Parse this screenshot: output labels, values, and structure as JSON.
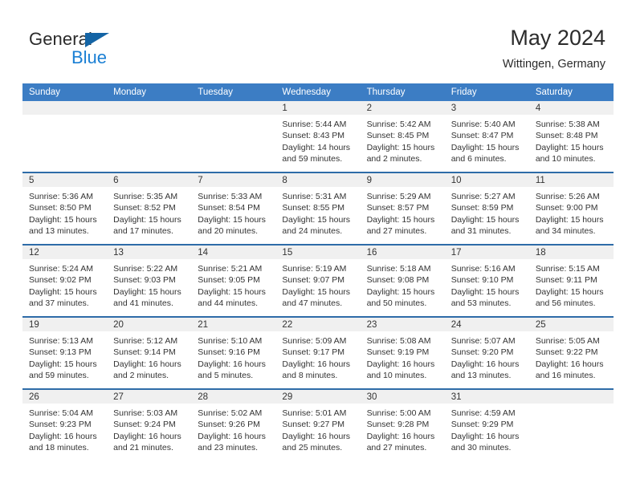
{
  "brand": {
    "name_part1": "General",
    "name_part2": "Blue",
    "triangle_color": "#1464a5",
    "blue_color": "#1a7fd4"
  },
  "header": {
    "title": "May 2024",
    "location": "Wittingen, Germany",
    "header_bg_color": "#3c7dc4",
    "row_border_color": "#2e6ca8"
  },
  "weekdays": [
    "Sunday",
    "Monday",
    "Tuesday",
    "Wednesday",
    "Thursday",
    "Friday",
    "Saturday"
  ],
  "weeks": [
    [
      {
        "day": "",
        "sunrise": "",
        "sunset": "",
        "daylight1": "",
        "daylight2": ""
      },
      {
        "day": "",
        "sunrise": "",
        "sunset": "",
        "daylight1": "",
        "daylight2": ""
      },
      {
        "day": "",
        "sunrise": "",
        "sunset": "",
        "daylight1": "",
        "daylight2": ""
      },
      {
        "day": "1",
        "sunrise": "Sunrise: 5:44 AM",
        "sunset": "Sunset: 8:43 PM",
        "daylight1": "Daylight: 14 hours",
        "daylight2": "and 59 minutes."
      },
      {
        "day": "2",
        "sunrise": "Sunrise: 5:42 AM",
        "sunset": "Sunset: 8:45 PM",
        "daylight1": "Daylight: 15 hours",
        "daylight2": "and 2 minutes."
      },
      {
        "day": "3",
        "sunrise": "Sunrise: 5:40 AM",
        "sunset": "Sunset: 8:47 PM",
        "daylight1": "Daylight: 15 hours",
        "daylight2": "and 6 minutes."
      },
      {
        "day": "4",
        "sunrise": "Sunrise: 5:38 AM",
        "sunset": "Sunset: 8:48 PM",
        "daylight1": "Daylight: 15 hours",
        "daylight2": "and 10 minutes."
      }
    ],
    [
      {
        "day": "5",
        "sunrise": "Sunrise: 5:36 AM",
        "sunset": "Sunset: 8:50 PM",
        "daylight1": "Daylight: 15 hours",
        "daylight2": "and 13 minutes."
      },
      {
        "day": "6",
        "sunrise": "Sunrise: 5:35 AM",
        "sunset": "Sunset: 8:52 PM",
        "daylight1": "Daylight: 15 hours",
        "daylight2": "and 17 minutes."
      },
      {
        "day": "7",
        "sunrise": "Sunrise: 5:33 AM",
        "sunset": "Sunset: 8:54 PM",
        "daylight1": "Daylight: 15 hours",
        "daylight2": "and 20 minutes."
      },
      {
        "day": "8",
        "sunrise": "Sunrise: 5:31 AM",
        "sunset": "Sunset: 8:55 PM",
        "daylight1": "Daylight: 15 hours",
        "daylight2": "and 24 minutes."
      },
      {
        "day": "9",
        "sunrise": "Sunrise: 5:29 AM",
        "sunset": "Sunset: 8:57 PM",
        "daylight1": "Daylight: 15 hours",
        "daylight2": "and 27 minutes."
      },
      {
        "day": "10",
        "sunrise": "Sunrise: 5:27 AM",
        "sunset": "Sunset: 8:59 PM",
        "daylight1": "Daylight: 15 hours",
        "daylight2": "and 31 minutes."
      },
      {
        "day": "11",
        "sunrise": "Sunrise: 5:26 AM",
        "sunset": "Sunset: 9:00 PM",
        "daylight1": "Daylight: 15 hours",
        "daylight2": "and 34 minutes."
      }
    ],
    [
      {
        "day": "12",
        "sunrise": "Sunrise: 5:24 AM",
        "sunset": "Sunset: 9:02 PM",
        "daylight1": "Daylight: 15 hours",
        "daylight2": "and 37 minutes."
      },
      {
        "day": "13",
        "sunrise": "Sunrise: 5:22 AM",
        "sunset": "Sunset: 9:03 PM",
        "daylight1": "Daylight: 15 hours",
        "daylight2": "and 41 minutes."
      },
      {
        "day": "14",
        "sunrise": "Sunrise: 5:21 AM",
        "sunset": "Sunset: 9:05 PM",
        "daylight1": "Daylight: 15 hours",
        "daylight2": "and 44 minutes."
      },
      {
        "day": "15",
        "sunrise": "Sunrise: 5:19 AM",
        "sunset": "Sunset: 9:07 PM",
        "daylight1": "Daylight: 15 hours",
        "daylight2": "and 47 minutes."
      },
      {
        "day": "16",
        "sunrise": "Sunrise: 5:18 AM",
        "sunset": "Sunset: 9:08 PM",
        "daylight1": "Daylight: 15 hours",
        "daylight2": "and 50 minutes."
      },
      {
        "day": "17",
        "sunrise": "Sunrise: 5:16 AM",
        "sunset": "Sunset: 9:10 PM",
        "daylight1": "Daylight: 15 hours",
        "daylight2": "and 53 minutes."
      },
      {
        "day": "18",
        "sunrise": "Sunrise: 5:15 AM",
        "sunset": "Sunset: 9:11 PM",
        "daylight1": "Daylight: 15 hours",
        "daylight2": "and 56 minutes."
      }
    ],
    [
      {
        "day": "19",
        "sunrise": "Sunrise: 5:13 AM",
        "sunset": "Sunset: 9:13 PM",
        "daylight1": "Daylight: 15 hours",
        "daylight2": "and 59 minutes."
      },
      {
        "day": "20",
        "sunrise": "Sunrise: 5:12 AM",
        "sunset": "Sunset: 9:14 PM",
        "daylight1": "Daylight: 16 hours",
        "daylight2": "and 2 minutes."
      },
      {
        "day": "21",
        "sunrise": "Sunrise: 5:10 AM",
        "sunset": "Sunset: 9:16 PM",
        "daylight1": "Daylight: 16 hours",
        "daylight2": "and 5 minutes."
      },
      {
        "day": "22",
        "sunrise": "Sunrise: 5:09 AM",
        "sunset": "Sunset: 9:17 PM",
        "daylight1": "Daylight: 16 hours",
        "daylight2": "and 8 minutes."
      },
      {
        "day": "23",
        "sunrise": "Sunrise: 5:08 AM",
        "sunset": "Sunset: 9:19 PM",
        "daylight1": "Daylight: 16 hours",
        "daylight2": "and 10 minutes."
      },
      {
        "day": "24",
        "sunrise": "Sunrise: 5:07 AM",
        "sunset": "Sunset: 9:20 PM",
        "daylight1": "Daylight: 16 hours",
        "daylight2": "and 13 minutes."
      },
      {
        "day": "25",
        "sunrise": "Sunrise: 5:05 AM",
        "sunset": "Sunset: 9:22 PM",
        "daylight1": "Daylight: 16 hours",
        "daylight2": "and 16 minutes."
      }
    ],
    [
      {
        "day": "26",
        "sunrise": "Sunrise: 5:04 AM",
        "sunset": "Sunset: 9:23 PM",
        "daylight1": "Daylight: 16 hours",
        "daylight2": "and 18 minutes."
      },
      {
        "day": "27",
        "sunrise": "Sunrise: 5:03 AM",
        "sunset": "Sunset: 9:24 PM",
        "daylight1": "Daylight: 16 hours",
        "daylight2": "and 21 minutes."
      },
      {
        "day": "28",
        "sunrise": "Sunrise: 5:02 AM",
        "sunset": "Sunset: 9:26 PM",
        "daylight1": "Daylight: 16 hours",
        "daylight2": "and 23 minutes."
      },
      {
        "day": "29",
        "sunrise": "Sunrise: 5:01 AM",
        "sunset": "Sunset: 9:27 PM",
        "daylight1": "Daylight: 16 hours",
        "daylight2": "and 25 minutes."
      },
      {
        "day": "30",
        "sunrise": "Sunrise: 5:00 AM",
        "sunset": "Sunset: 9:28 PM",
        "daylight1": "Daylight: 16 hours",
        "daylight2": "and 27 minutes."
      },
      {
        "day": "31",
        "sunrise": "Sunrise: 4:59 AM",
        "sunset": "Sunset: 9:29 PM",
        "daylight1": "Daylight: 16 hours",
        "daylight2": "and 30 minutes."
      },
      {
        "day": "",
        "sunrise": "",
        "sunset": "",
        "daylight1": "",
        "daylight2": ""
      }
    ]
  ]
}
